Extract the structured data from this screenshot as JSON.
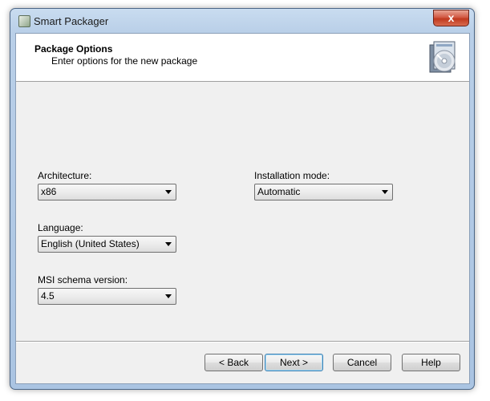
{
  "window": {
    "title": "Smart Packager",
    "close_label": "x"
  },
  "header": {
    "title": "Package Options",
    "subtitle": "Enter options for the new package",
    "icon": "package-cd-icon"
  },
  "form": {
    "architecture": {
      "label": "Architecture:",
      "value": "x86"
    },
    "installation_mode": {
      "label": "Installation mode:",
      "value": "Automatic"
    },
    "language": {
      "label": "Language:",
      "value": "English (United States)"
    },
    "msi_schema": {
      "label": "MSI schema version:",
      "value": "4.5"
    }
  },
  "buttons": {
    "back": "< Back",
    "next": "Next >",
    "cancel": "Cancel",
    "help": "Help"
  },
  "colors": {
    "window_frame": "#b9cfe8",
    "close_button": "#c0391f",
    "client_background": "#f0f0f0",
    "default_button_border": "#3c7fb1"
  }
}
